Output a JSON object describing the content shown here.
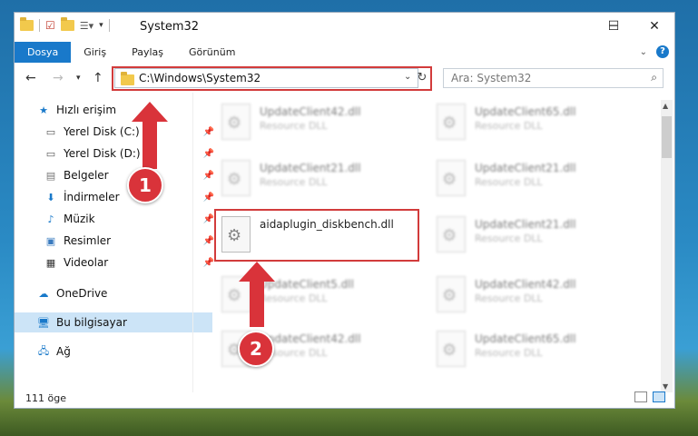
{
  "window": {
    "title": "System32",
    "controls": {
      "minimize": "─",
      "maximize": "☐",
      "close": "✕"
    }
  },
  "ribbon": {
    "tabs": [
      "Dosya",
      "Giriş",
      "Paylaş",
      "Görünüm"
    ],
    "active_tab": "Dosya",
    "help": "?"
  },
  "nav": {
    "address": "C:\\Windows\\System32",
    "search_placeholder": "Ara: System32"
  },
  "sidebar": {
    "items": [
      {
        "label": "Hızlı erişim",
        "icon": "star-icon"
      },
      {
        "label": "Yerel Disk (C:)",
        "icon": "drive-icon",
        "pinned": true
      },
      {
        "label": "Yerel Disk (D:)",
        "icon": "drive-icon",
        "pinned": true
      },
      {
        "label": "Belgeler",
        "icon": "documents-icon",
        "pinned": true
      },
      {
        "label": "İndirmeler",
        "icon": "download-icon",
        "pinned": true
      },
      {
        "label": "Müzik",
        "icon": "music-icon",
        "pinned": true
      },
      {
        "label": "Resimler",
        "icon": "pictures-icon",
        "pinned": true
      },
      {
        "label": "Videolar",
        "icon": "videos-icon",
        "pinned": true
      },
      {
        "label": "OneDrive",
        "icon": "onedrive-icon"
      },
      {
        "label": "Bu bilgisayar",
        "icon": "computer-icon",
        "selected": true
      },
      {
        "label": "Ağ",
        "icon": "network-icon"
      }
    ]
  },
  "files": [
    {
      "name": "UpdateClient42.dll",
      "type": "Resource DLL"
    },
    {
      "name": "UpdateClient65.dll",
      "type": "Resource DLL"
    },
    {
      "name": "UpdateClient21.dll",
      "type": "Resource DLL"
    },
    {
      "name": "UpdateClient21.dll",
      "type": "Resource DLL"
    },
    {
      "name": "aidaplugin_diskbench.dll",
      "type": ""
    },
    {
      "name": "UpdateClient21.dll",
      "type": "Resource DLL"
    },
    {
      "name": "UpdateClient5.dll",
      "type": "Resource DLL"
    },
    {
      "name": "UpdateClient42.dll",
      "type": "Resource DLL"
    },
    {
      "name": "UpdateClient42.dll",
      "type": "Resource DLL"
    },
    {
      "name": "UpdateClient65.dll",
      "type": "Resource DLL"
    }
  ],
  "status": {
    "item_count": "111 öge"
  },
  "annotations": {
    "step1": "1",
    "step2": "2"
  },
  "colors": {
    "accent": "#1979ca",
    "highlight": "#d23b3b",
    "selection": "#cce4f7"
  }
}
